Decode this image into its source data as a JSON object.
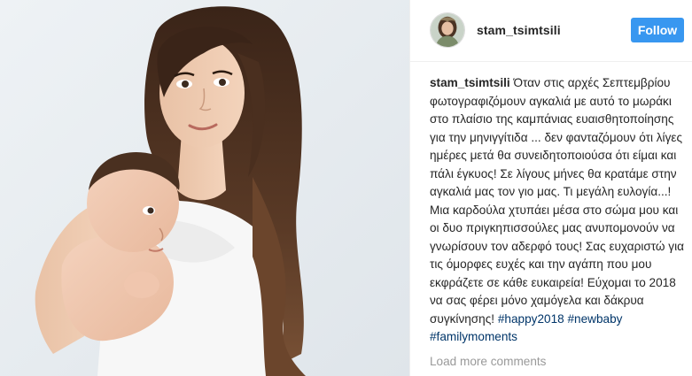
{
  "post": {
    "username": "stam_tsimtsili",
    "follow_label": "Follow",
    "caption_text": "Όταν στις αρχές Σεπτεμβρίου φωτογραφιζόμουν αγκαλιά με αυτό το μωράκι στο πλαίσιο της καμπάνιας ευαισθητοποίησης για την μηνιγγίτιδα ... δεν φανταζόμουν ότι λίγες ημέρες μετά θα συνειδητοποιούσα ότι είμαι και πάλι έγκυος! Σε λίγους μήνες θα κρατάμε στην αγκαλιά μας τον γιο μας. Τι μεγάλη ευλογία...! Μια καρδούλα χτυπάει μέσα στο σώμα μου και οι δυο πριγκηπισσούλες μας ανυπομονούν να γνωρίσουν τον αδερφό τους! Σας ευχαριστώ για τις όμορφες ευχές και την αγάπη που μου εκφράζετε σε κάθε ευκαιρεία! Εύχομαι το 2018 να σας φέρει μόνο χαμόγελα και δάκρυα συγκίνησης!",
    "hashtags": [
      "#happy2018",
      "#newbaby",
      "#familymoments"
    ],
    "load_more_label": "Load more comments"
  },
  "colors": {
    "follow_button": "#3897f0",
    "hashtag": "#003569",
    "muted": "#999999",
    "text": "#262626"
  },
  "icons": {
    "avatar": "profile-avatar",
    "photo": "woman-holding-baby-photo"
  }
}
